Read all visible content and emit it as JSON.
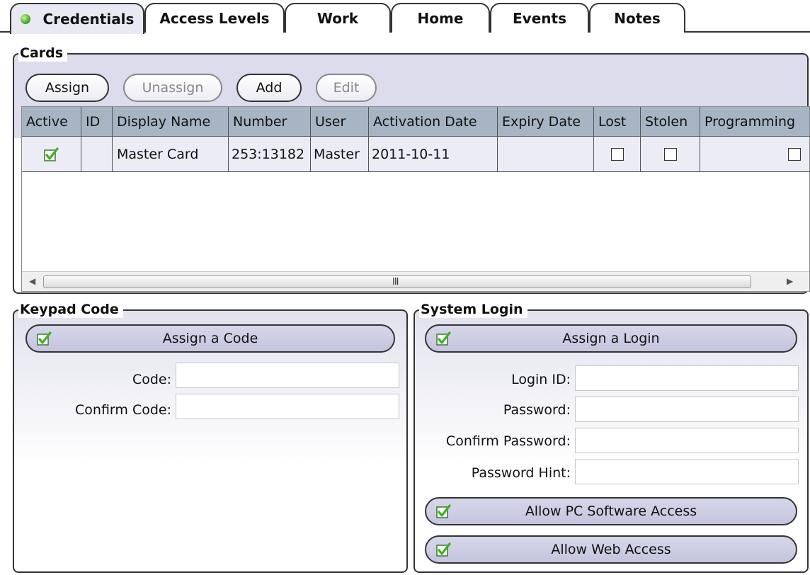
{
  "tabs": [
    {
      "label": "Credentials",
      "active": true
    },
    {
      "label": "Access Levels",
      "active": false
    },
    {
      "label": "Work",
      "active": false
    },
    {
      "label": "Home",
      "active": false
    },
    {
      "label": "Events",
      "active": false
    },
    {
      "label": "Notes",
      "active": false
    }
  ],
  "cards": {
    "title": "Cards",
    "buttons": {
      "assign": "Assign",
      "unassign": "Unassign",
      "add": "Add",
      "edit": "Edit"
    },
    "columns": [
      "Active",
      "ID",
      "Display Name",
      "Number",
      "User",
      "Activation Date",
      "Expiry Date",
      "Lost",
      "Stolen",
      "Programming"
    ],
    "rows": [
      {
        "active": true,
        "id": "",
        "display_name": "Master Card",
        "number": "253:13182",
        "user": "Master",
        "activation_date": "2011-10-11",
        "expiry_date": "",
        "lost": false,
        "stolen": false,
        "programming": false
      }
    ],
    "scroll_grip": "III"
  },
  "keypad": {
    "title": "Keypad Code",
    "assign_label": "Assign a Code",
    "code_label": "Code:",
    "code_value": "",
    "confirm_label": "Confirm Code:",
    "confirm_value": ""
  },
  "login": {
    "title": "System Login",
    "assign_label": "Assign a Login",
    "login_id_label": "Login ID:",
    "password_label": "Password:",
    "confirm_password_label": "Confirm Password:",
    "password_hint_label": "Password Hint:",
    "pc_access_label": "Allow PC Software Access",
    "web_access_label": "Allow Web Access"
  },
  "colors": {
    "accent_green": "#45b020",
    "header_blue": "#a7b4c4",
    "panel_lavender": "#dcdcec"
  }
}
